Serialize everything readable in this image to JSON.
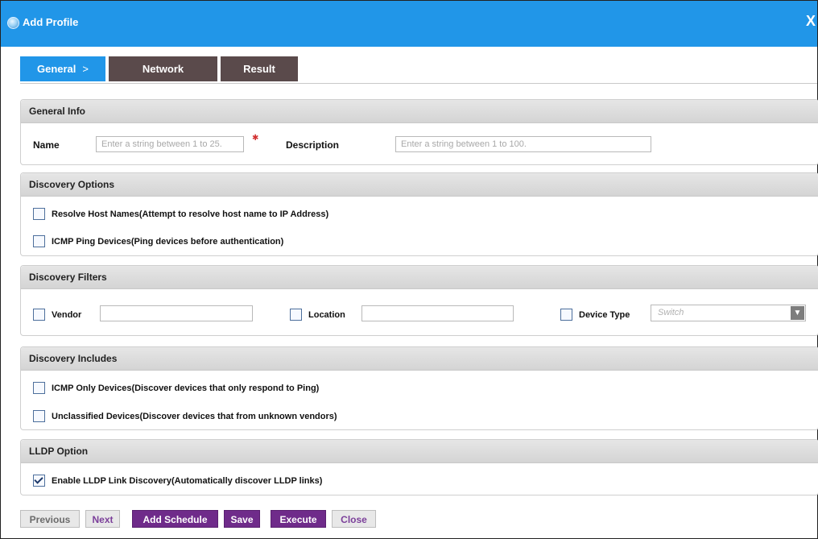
{
  "window": {
    "title": "Add Profile",
    "close_glyph": "X"
  },
  "wizard": {
    "steps": [
      {
        "label": "General",
        "chevron": ">"
      },
      {
        "label": "Network"
      },
      {
        "label": "Result"
      }
    ]
  },
  "general_info": {
    "header": "General Info",
    "name_label": "Name",
    "name_placeholder": "Enter a string between 1 to 25.",
    "description_label": "Description",
    "description_placeholder": "Enter a string between 1 to 100."
  },
  "discovery_options": {
    "header": "Discovery Options",
    "items": [
      {
        "label": "Resolve Host Names(Attempt to resolve host name to IP Address)",
        "checked": false
      },
      {
        "label": "ICMP Ping Devices(Ping devices before authentication)",
        "checked": false
      }
    ]
  },
  "discovery_filters": {
    "header": "Discovery Filters",
    "vendor_label": "Vendor",
    "location_label": "Location",
    "device_type_label": "Device Type",
    "device_type_value": "Switch"
  },
  "discovery_includes": {
    "header": "Discovery Includes",
    "items": [
      {
        "label": "ICMP Only Devices(Discover devices that only respond to Ping)",
        "checked": false
      },
      {
        "label": "Unclassified Devices(Discover devices that from unknown vendors)",
        "checked": false
      }
    ]
  },
  "lldp_option": {
    "header": "LLDP Option",
    "items": [
      {
        "label": "Enable LLDP Link Discovery(Automatically discover LLDP links)",
        "checked": true
      }
    ]
  },
  "buttons": {
    "previous": "Previous",
    "next": "Next",
    "add_schedule": "Add Schedule",
    "save": "Save",
    "execute": "Execute",
    "close": "Close"
  },
  "colors": {
    "title_bar": "#2196e8",
    "active_step": "#2196e8",
    "inactive_step": "#5a4a4b",
    "primary_button": "#6f2b8a"
  }
}
